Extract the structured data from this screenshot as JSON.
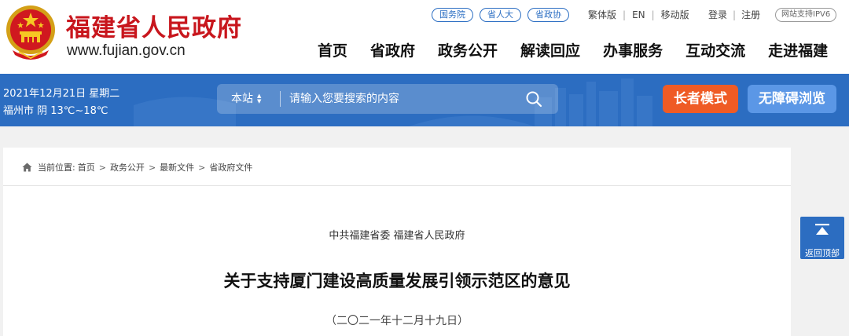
{
  "header": {
    "site_title": "福建省人民政府",
    "site_url": "www.fujian.gov.cn",
    "emblem_icon": "national-emblem-icon",
    "gov_links": [
      "国务院",
      "省人大",
      "省政协"
    ],
    "util_links": [
      "繁体版",
      "EN",
      "移动版"
    ],
    "login_links": [
      "登录",
      "注册"
    ],
    "ipv6_badge": "网站支持IPV6",
    "nav": [
      "首页",
      "省政府",
      "政务公开",
      "解读回应",
      "办事服务",
      "互动交流",
      "走进福建"
    ]
  },
  "banner": {
    "date": "2021年12月21日 星期二",
    "weather": "福州市 阴 13℃~18℃",
    "search": {
      "scope": "本站",
      "placeholder": "请输入您要搜索的内容",
      "icon": "search-icon"
    },
    "elder_mode": "长者模式",
    "accessibility": "无障碍浏览"
  },
  "breadcrumb": {
    "icon": "home-icon",
    "prefix": "当前位置:",
    "items": [
      "首页",
      "政务公开",
      "最新文件",
      "省政府文件"
    ]
  },
  "document": {
    "issuer": "中共福建省委 福建省人民政府",
    "title": "关于支持厦门建设高质量发展引领示范区的意见",
    "date": "（二〇二一年十二月十九日）"
  },
  "back_to_top": {
    "label": "返回顶部",
    "icon": "arrow-up-icon"
  },
  "colors": {
    "brand_red": "#c8161d",
    "banner_blue": "#2c6dc1",
    "elder_orange": "#ef5b25",
    "access_blue": "#5b97e6"
  }
}
